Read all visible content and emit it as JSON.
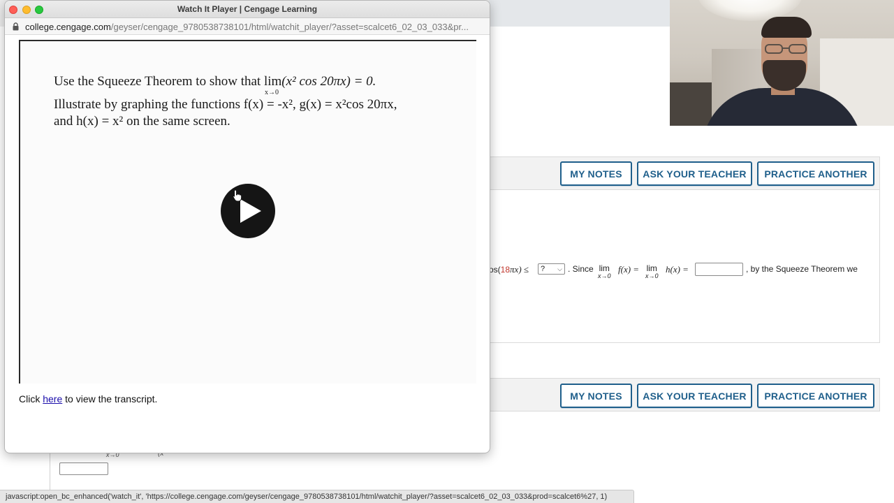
{
  "popup": {
    "title": "Watch It Player | Cengage Learning",
    "url_domain": "college.cengage.com",
    "url_path": "/geyser/cengage_9780538738101/html/watchit_player/?asset=scalcet6_02_03_033&pr...",
    "problem": {
      "line1_prefix": "Use the Squeeze Theorem to show that ",
      "line1_lim": "lim",
      "line1_lim_sub": "x→0",
      "line1_expr": "(x² cos 20πx) = 0.",
      "line2": "Illustrate by graphing the functions f(x) = -x², g(x) = x²cos 20πx,",
      "line3": "and h(x) = x² on the same screen."
    },
    "transcript_prefix": "Click ",
    "transcript_link": "here",
    "transcript_suffix": " to view the transcript."
  },
  "question1": {
    "buttons": {
      "my_notes": "MY NOTES",
      "ask_teacher": "ASK YOUR TEACHER",
      "practice_another": "PRACTICE ANOTHER"
    },
    "text": {
      "frag_cos": "os(",
      "coef": "18",
      "frag_pix": "πx) ≤",
      "select_value": "?",
      "since": ". Since",
      "lim1": "lim",
      "lim1_sub": "x→0",
      "fx": "f(x) =",
      "lim2": "lim",
      "lim2_sub": "x→0",
      "hx": "h(x) =",
      "tail": ", by the Squeeze Theorem we"
    }
  },
  "question2": {
    "buttons": {
      "my_notes": "MY NOTES",
      "ask_teacher": "ASK YOUR TEACHER",
      "practice_another": "PRACTICE ANOTHER"
    },
    "frag_sub": "x→0",
    "frag_x": "(x"
  },
  "status_bar": {
    "text": "javascript:open_bc_enhanced('watch_it', 'https://college.cengage.com/geyser/cengage_9780538738101/html/watchit_player/?asset=scalcet6_02_03_033&prod=scalcet6%27, 1)"
  },
  "icons": {
    "play": "play-icon",
    "lock": "lock-icon",
    "cursor": "hand-cursor-icon",
    "dropdown": "chevron-down-icon"
  }
}
